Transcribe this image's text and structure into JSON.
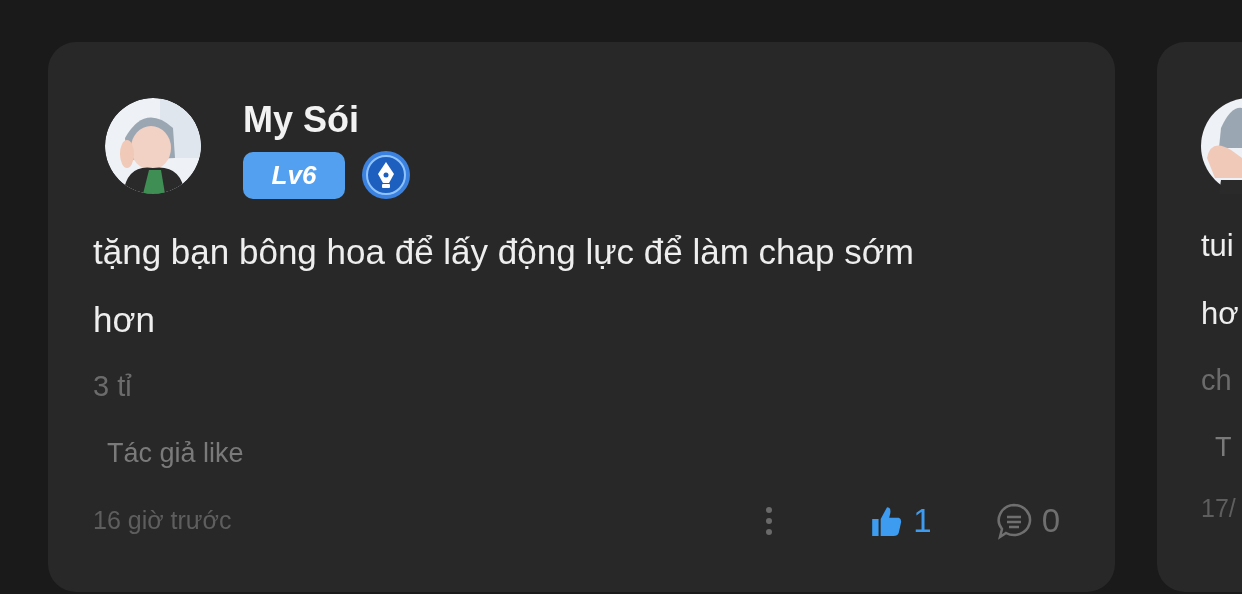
{
  "comments": [
    {
      "author": "My Sói",
      "level_badge": "Lv6",
      "has_writer_badge": true,
      "text": "tặng bạn bông hoa để lấy động lực để làm chap sớm hơn",
      "gift": "3 tỉ",
      "author_note": "Tác giả like",
      "time": "16 giờ trước",
      "liked": true,
      "like_count": "1",
      "comment_count": "0"
    },
    {
      "text_lines": [
        "tui",
        "hơ"
      ],
      "gift": "ch",
      "author_note": "T",
      "time": "17/"
    }
  ]
}
